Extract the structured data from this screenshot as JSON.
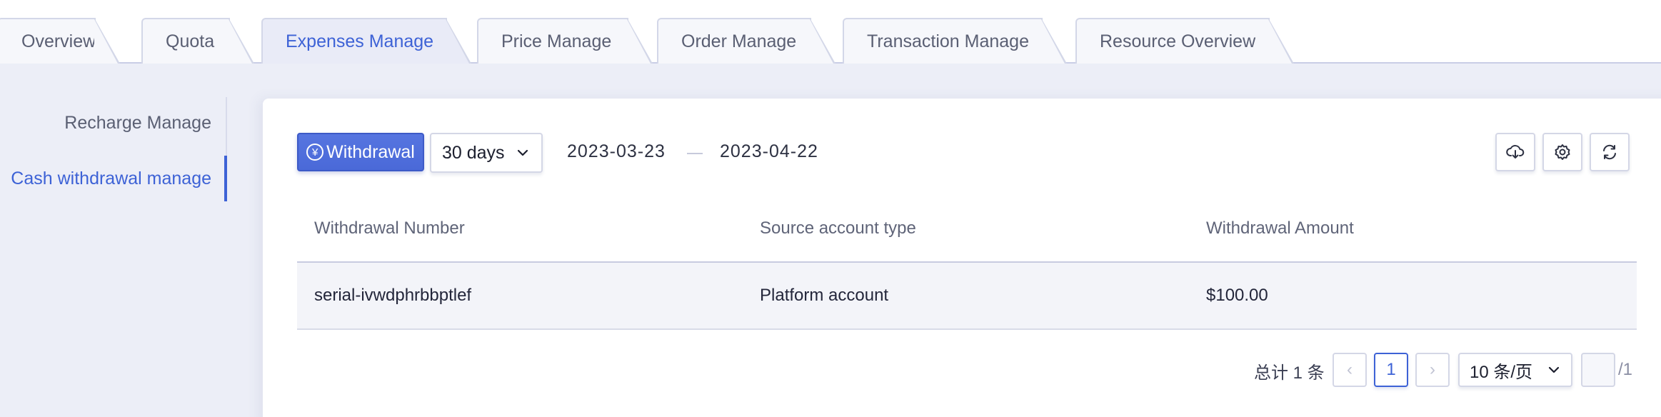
{
  "tabs": [
    {
      "label": "Overview",
      "active": false
    },
    {
      "label": "Quota",
      "active": false
    },
    {
      "label": "Expenses Manage",
      "active": true
    },
    {
      "label": "Price Manage",
      "active": false
    },
    {
      "label": "Order Manage",
      "active": false
    },
    {
      "label": "Transaction Manage",
      "active": false
    },
    {
      "label": "Resource Overview",
      "active": false
    }
  ],
  "submenu": {
    "items": [
      {
        "label": "Recharge Manage",
        "active": false
      },
      {
        "label": "Cash withdrawal manage",
        "active": true
      }
    ]
  },
  "toolbar": {
    "withdraw_icon": "¥",
    "withdraw_label": "Withdrawal",
    "range_select": "30 days",
    "date_start": "2023-03-23",
    "date_end": "2023-04-22",
    "icons": [
      "cloud-download-icon",
      "gear-icon",
      "refresh-icon"
    ]
  },
  "table": {
    "columns": [
      "Withdrawal Number",
      "Source account type",
      "Withdrawal Amount"
    ],
    "rows": [
      [
        "serial-ivwdphrbbptlef",
        "Platform account",
        "$100.00"
      ]
    ]
  },
  "pagination": {
    "total_text": "总计 1 条",
    "prev": "‹",
    "current_page": "1",
    "next": "›",
    "page_size": "10 条/页",
    "total_pages_text": "/1"
  },
  "colors": {
    "accent": "#3d62d6",
    "background": "#eceef7"
  }
}
